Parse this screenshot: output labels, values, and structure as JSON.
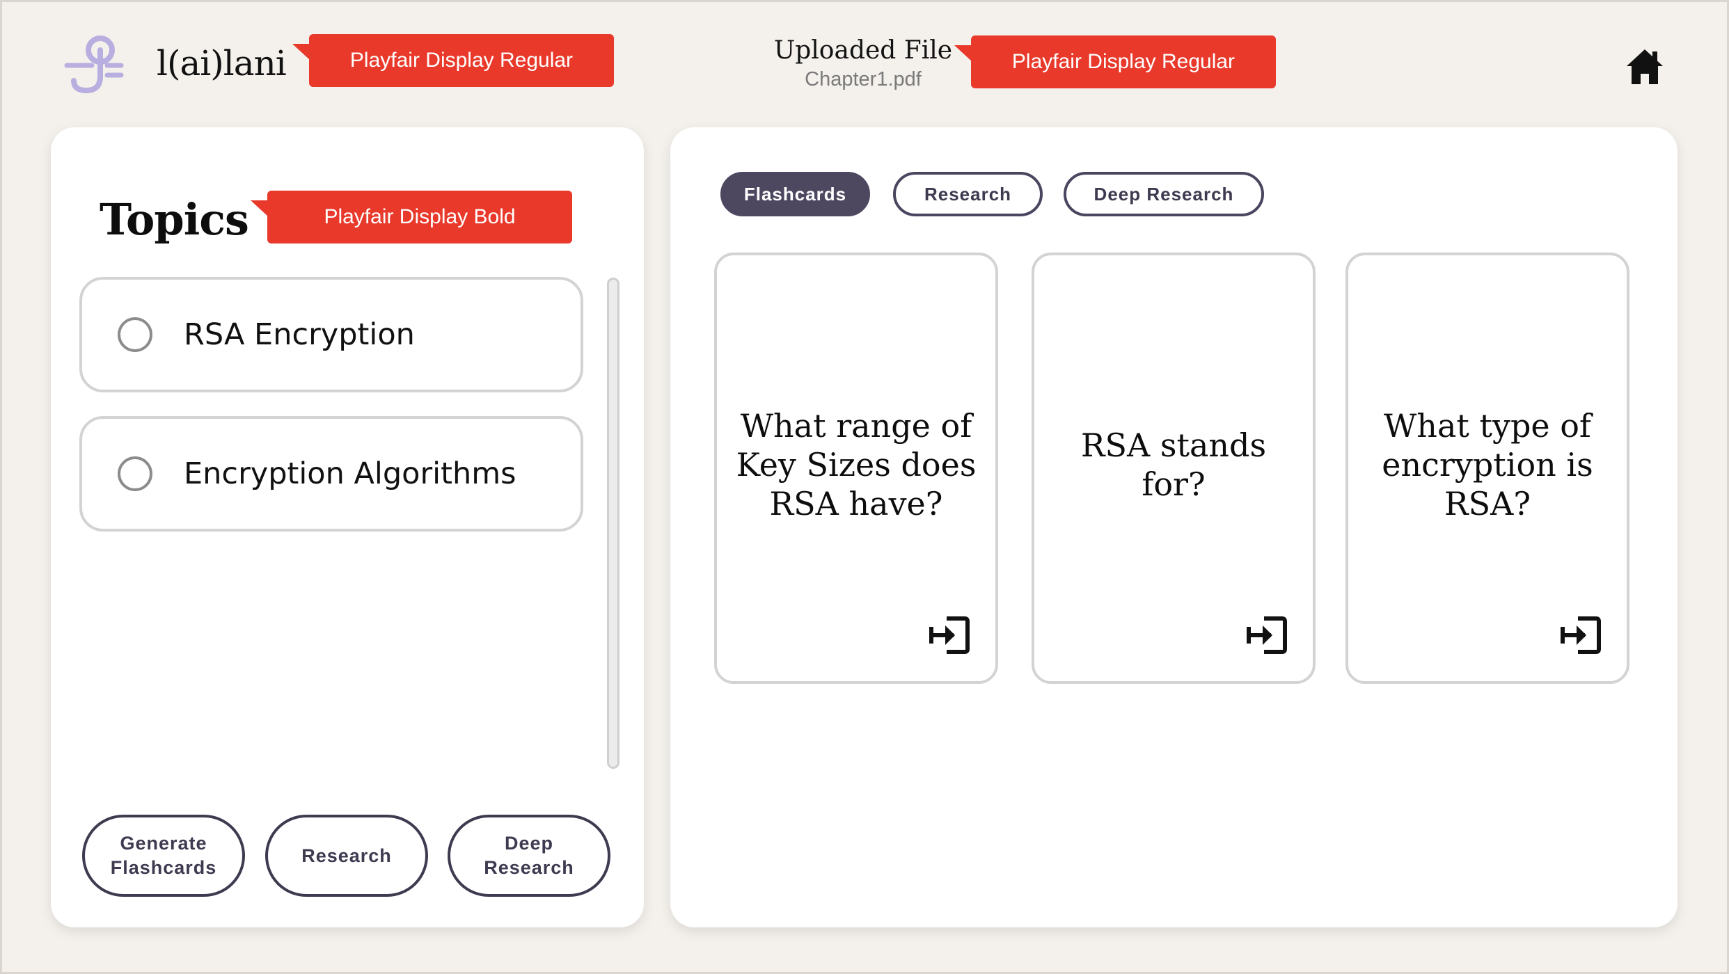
{
  "header": {
    "brand": "l(ai)lani",
    "brand_callout": "Playfair Display Regular",
    "file_title": "Uploaded File",
    "file_name": "Chapter1.pdf",
    "file_callout": "Playfair Display Regular",
    "home_icon": "home-icon",
    "logo_icon": "logo-icon"
  },
  "topics": {
    "title": "Topics",
    "title_callout": "Playfair Display Bold",
    "items": [
      {
        "label": "RSA Encryption"
      },
      {
        "label": "Encryption Algorithms"
      }
    ],
    "buttons": {
      "generate": "Generate Flashcards",
      "research": "Research",
      "deep_research": "Deep Research"
    }
  },
  "tabs": [
    {
      "label": "Flashcards",
      "active": true
    },
    {
      "label": "Research",
      "active": false
    },
    {
      "label": "Deep Research",
      "active": false
    }
  ],
  "cards": [
    {
      "question": "What range of Key Sizes does RSA have?",
      "icon": "open-card-icon"
    },
    {
      "question": "RSA stands for?",
      "icon": "open-card-icon"
    },
    {
      "question": "What type of encryption is RSA?",
      "icon": "open-card-icon"
    }
  ],
  "colors": {
    "accent": "#4d4760",
    "callout": "#e8392b",
    "logo": "#b9aee0",
    "background": "#f4f1ec"
  }
}
